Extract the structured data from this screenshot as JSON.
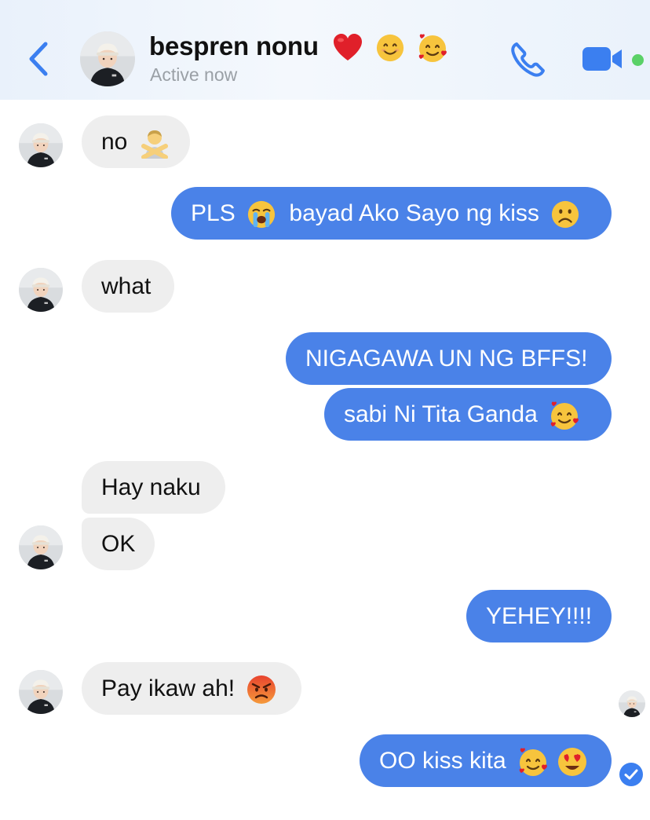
{
  "header": {
    "contact_name": "bespren nonu",
    "status": "Active now",
    "name_emojis": [
      "heart-emoji",
      "smiling-face-emoji",
      "smiling-face-with-hearts-emoji"
    ]
  },
  "icons": {
    "back": "chevron-left-icon",
    "call": "phone-icon",
    "video": "video-camera-icon"
  },
  "colors": {
    "accent": "#3b7ff0",
    "outgoing_bubble": "#4a82e8",
    "incoming_bubble": "#eeeeee",
    "online": "#5ad167"
  },
  "messages": [
    {
      "sender": "contact",
      "text": "no",
      "emoji": "person-gesturing-no-emoji"
    },
    {
      "sender": "me",
      "text": "PLS",
      "emoji": "loudly-crying-face-emoji",
      "text2": "bayad Ako Sayo ng kiss",
      "emoji2": "frowning-face-emoji"
    },
    {
      "sender": "contact",
      "text": "what"
    },
    {
      "sender": "me",
      "text": "NIGAGAWA UN NG BFFS!"
    },
    {
      "sender": "me",
      "text": "sabi Ni Tita Ganda",
      "emoji": "smiling-face-with-hearts-emoji"
    },
    {
      "sender": "contact",
      "text": "Hay naku"
    },
    {
      "sender": "contact",
      "text": "OK"
    },
    {
      "sender": "me",
      "text": "YEHEY!!!!"
    },
    {
      "sender": "contact",
      "text": "Pay ikaw ah!",
      "emoji": "angry-face-emoji"
    },
    {
      "sender": "me",
      "text": "OO kiss kita",
      "emoji": "smiling-face-with-hearts-emoji",
      "emoji2": "heart-eyes-emoji"
    }
  ]
}
